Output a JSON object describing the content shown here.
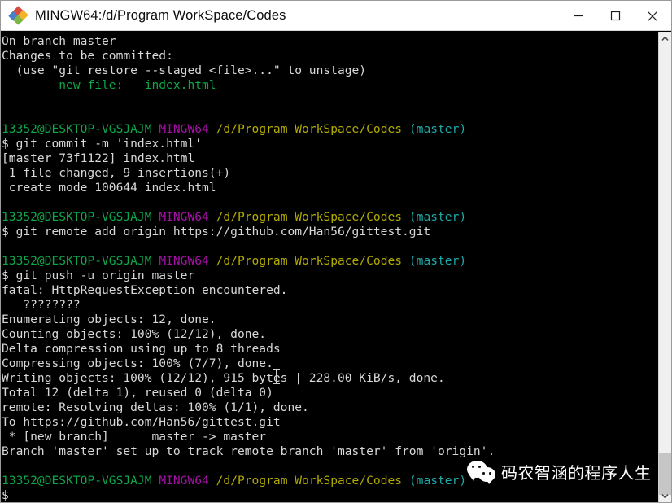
{
  "window": {
    "title": "MINGW64:/d/Program WorkSpace/Codes",
    "icon": "git-bash-diamonds-icon",
    "controls": {
      "minimize": "minimize-icon",
      "maximize": "maximize-icon",
      "close": "close-icon"
    }
  },
  "colors": {
    "background": "#000000",
    "foreground": "#d8d8d8",
    "green": "#0ea64a",
    "purple": "#a90fa9",
    "yellow": "#b3ab00",
    "cyan": "#1fa8a8",
    "titlebar": "#ffffff",
    "scrollbar_track": "#f0f0f0",
    "scrollbar_thumb": "#c6c6c6"
  },
  "prompt": {
    "user_host": "13352@DESKTOP-VGSJAJM",
    "shell": "MINGW64",
    "path": "/d/Program WorkSpace/Codes",
    "branch": "(master)",
    "symbol": "$"
  },
  "terminal": {
    "lines": [
      {
        "segments": [
          {
            "text": "On branch master",
            "color": "white"
          }
        ]
      },
      {
        "segments": [
          {
            "text": "Changes to be committed:",
            "color": "white"
          }
        ]
      },
      {
        "segments": [
          {
            "text": "  (use \"git restore --staged <file>...\" to unstage)",
            "color": "white"
          }
        ]
      },
      {
        "segments": [
          {
            "text": "        new file:   index.html",
            "color": "green"
          }
        ]
      },
      {
        "segments": [
          {
            "text": "",
            "color": "white"
          }
        ]
      },
      {
        "segments": [
          {
            "text": "",
            "color": "white"
          }
        ]
      },
      {
        "segments": [
          {
            "text": "13352@DESKTOP-VGSJAJM",
            "color": "green"
          },
          {
            "text": " ",
            "color": "white"
          },
          {
            "text": "MINGW64",
            "color": "purple"
          },
          {
            "text": " ",
            "color": "white"
          },
          {
            "text": "/d/Program WorkSpace/Codes",
            "color": "yellow"
          },
          {
            "text": " ",
            "color": "white"
          },
          {
            "text": "(master)",
            "color": "cyan"
          }
        ]
      },
      {
        "segments": [
          {
            "text": "$ git commit -m 'index.html'",
            "color": "white"
          }
        ]
      },
      {
        "segments": [
          {
            "text": "[master 73f1122] index.html",
            "color": "white"
          }
        ]
      },
      {
        "segments": [
          {
            "text": " 1 file changed, 9 insertions(+)",
            "color": "white"
          }
        ]
      },
      {
        "segments": [
          {
            "text": " create mode 100644 index.html",
            "color": "white"
          }
        ]
      },
      {
        "segments": [
          {
            "text": "",
            "color": "white"
          }
        ]
      },
      {
        "segments": [
          {
            "text": "13352@DESKTOP-VGSJAJM",
            "color": "green"
          },
          {
            "text": " ",
            "color": "white"
          },
          {
            "text": "MINGW64",
            "color": "purple"
          },
          {
            "text": " ",
            "color": "white"
          },
          {
            "text": "/d/Program WorkSpace/Codes",
            "color": "yellow"
          },
          {
            "text": " ",
            "color": "white"
          },
          {
            "text": "(master)",
            "color": "cyan"
          }
        ]
      },
      {
        "segments": [
          {
            "text": "$ git remote add origin https://github.com/Han56/gittest.git",
            "color": "white"
          }
        ]
      },
      {
        "segments": [
          {
            "text": "",
            "color": "white"
          }
        ]
      },
      {
        "segments": [
          {
            "text": "13352@DESKTOP-VGSJAJM",
            "color": "green"
          },
          {
            "text": " ",
            "color": "white"
          },
          {
            "text": "MINGW64",
            "color": "purple"
          },
          {
            "text": " ",
            "color": "white"
          },
          {
            "text": "/d/Program WorkSpace/Codes",
            "color": "yellow"
          },
          {
            "text": " ",
            "color": "white"
          },
          {
            "text": "(master)",
            "color": "cyan"
          }
        ]
      },
      {
        "segments": [
          {
            "text": "$ git push -u origin master",
            "color": "white"
          }
        ]
      },
      {
        "segments": [
          {
            "text": "fatal: HttpRequestException encountered.",
            "color": "white"
          }
        ]
      },
      {
        "segments": [
          {
            "text": "   ????????",
            "color": "white"
          }
        ]
      },
      {
        "segments": [
          {
            "text": "Enumerating objects: 12, done.",
            "color": "white"
          }
        ]
      },
      {
        "segments": [
          {
            "text": "Counting objects: 100% (12/12), done.",
            "color": "white"
          }
        ]
      },
      {
        "segments": [
          {
            "text": "Delta compression using up to 8 threads",
            "color": "white"
          }
        ]
      },
      {
        "segments": [
          {
            "text": "Compressing objects: 100% (7/7), done.",
            "color": "white"
          }
        ]
      },
      {
        "segments": [
          {
            "text": "Writing objects: 100% (12/12), 915 bytes | 228.00 KiB/s, done.",
            "color": "white"
          }
        ]
      },
      {
        "segments": [
          {
            "text": "Total 12 (delta 1), reused 0 (delta 0)",
            "color": "white"
          }
        ]
      },
      {
        "segments": [
          {
            "text": "remote: Resolving deltas: 100% (1/1), done.",
            "color": "white"
          }
        ]
      },
      {
        "segments": [
          {
            "text": "To https://github.com/Han56/gittest.git",
            "color": "white"
          }
        ]
      },
      {
        "segments": [
          {
            "text": " * [new branch]      master -> master",
            "color": "white"
          }
        ]
      },
      {
        "segments": [
          {
            "text": "Branch 'master' set up to track remote branch 'master' from 'origin'.",
            "color": "white"
          }
        ]
      },
      {
        "segments": [
          {
            "text": "",
            "color": "white"
          }
        ]
      },
      {
        "segments": [
          {
            "text": "13352@DESKTOP-VGSJAJM",
            "color": "green"
          },
          {
            "text": " ",
            "color": "white"
          },
          {
            "text": "MINGW64",
            "color": "purple"
          },
          {
            "text": " ",
            "color": "white"
          },
          {
            "text": "/d/Program WorkSpace/Codes",
            "color": "yellow"
          },
          {
            "text": " ",
            "color": "white"
          },
          {
            "text": "(master)",
            "color": "cyan"
          }
        ]
      },
      {
        "segments": [
          {
            "text": "$",
            "color": "white"
          }
        ]
      }
    ]
  },
  "watermark": {
    "logo": "wechat-logo-icon",
    "text": "码农智涵的程序人生"
  },
  "scrollbar": {
    "up_arrow": "chevron-up-icon",
    "down_arrow": "chevron-down-icon"
  }
}
